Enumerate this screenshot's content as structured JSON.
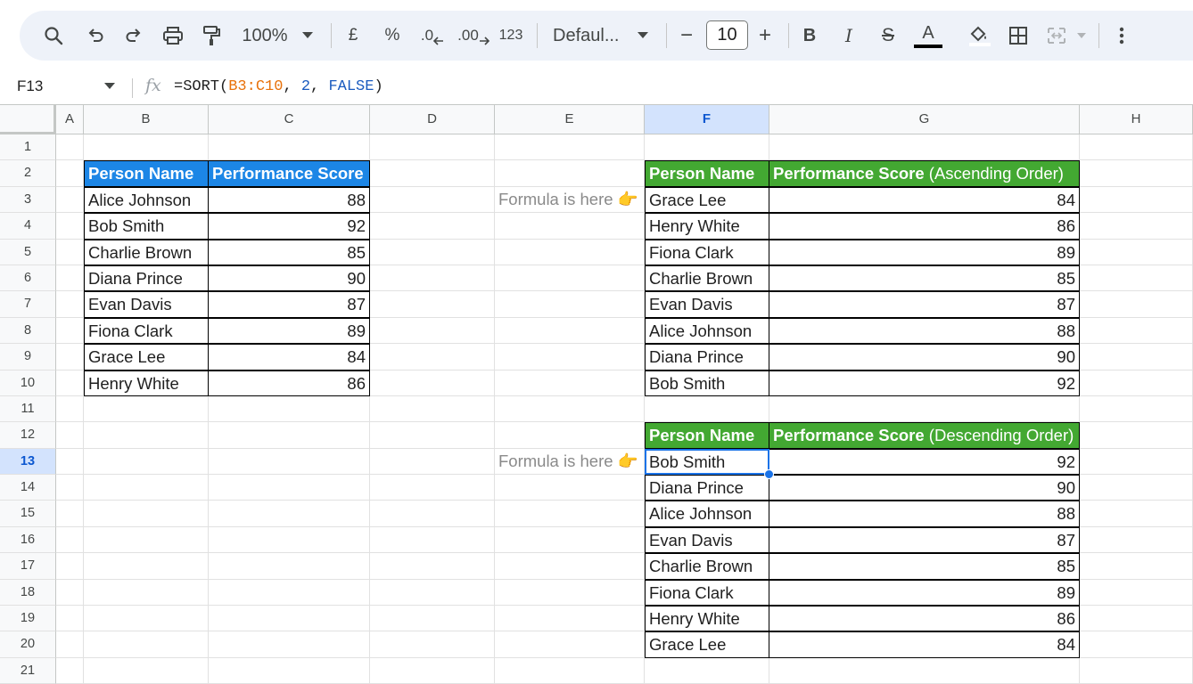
{
  "toolbar": {
    "zoom": "100%",
    "currency": "£",
    "percent": "%",
    "decrease_decimal": ".0",
    "increase_decimal": ".00",
    "more_formats": "123",
    "font": "Defaul...",
    "font_size": "10",
    "minus": "−",
    "plus": "+",
    "bold": "B",
    "italic": "I",
    "strike": "S",
    "text_color_letter": "A",
    "text_color": "#000000"
  },
  "formula_bar": {
    "name_box": "F13",
    "fx": "fx",
    "f_prefix": "=SORT(",
    "f_range": "B3:C10",
    "f_comma1": ", ",
    "f_num": "2",
    "f_comma2": ", ",
    "f_bool": "FALSE",
    "f_suffix": ")"
  },
  "columns": [
    "A",
    "B",
    "C",
    "D",
    "E",
    "F",
    "G",
    "H"
  ],
  "rows": [
    "1",
    "2",
    "3",
    "4",
    "5",
    "6",
    "7",
    "8",
    "9",
    "10",
    "11",
    "12",
    "13",
    "14",
    "15",
    "16",
    "17",
    "18",
    "19",
    "20",
    "21"
  ],
  "source_table": {
    "header_name": "Person Name",
    "header_score": "Performance Score",
    "rows": [
      {
        "name": "Alice Johnson",
        "score": "88"
      },
      {
        "name": "Bob Smith",
        "score": "92"
      },
      {
        "name": "Charlie Brown",
        "score": "85"
      },
      {
        "name": "Diana Prince",
        "score": "90"
      },
      {
        "name": "Evan Davis",
        "score": "87"
      },
      {
        "name": "Fiona Clark",
        "score": "89"
      },
      {
        "name": "Grace Lee",
        "score": "84"
      },
      {
        "name": "Henry White",
        "score": "86"
      }
    ]
  },
  "notes": {
    "ascending": "Formula is here 👉",
    "descending": "Formula is here 👉"
  },
  "ascending_table": {
    "header_name": "Person Name",
    "header_score_bold": "Performance Score",
    "header_score_rest": " (Ascending Order)",
    "rows": [
      {
        "name": "Grace Lee",
        "score": "84"
      },
      {
        "name": "Henry White",
        "score": "86"
      },
      {
        "name": "Fiona Clark",
        "score": "89"
      },
      {
        "name": "Charlie Brown",
        "score": "85"
      },
      {
        "name": "Evan Davis",
        "score": "87"
      },
      {
        "name": "Alice Johnson",
        "score": "88"
      },
      {
        "name": "Diana Prince",
        "score": "90"
      },
      {
        "name": "Bob Smith",
        "score": "92"
      }
    ]
  },
  "descending_table": {
    "header_name": "Person Name",
    "header_score_bold": "Performance Score",
    "header_score_rest": " (Descending Order)",
    "rows": [
      {
        "name": "Bob Smith",
        "score": "92"
      },
      {
        "name": "Diana Prince",
        "score": "90"
      },
      {
        "name": "Alice Johnson",
        "score": "88"
      },
      {
        "name": "Evan Davis",
        "score": "87"
      },
      {
        "name": "Charlie Brown",
        "score": "85"
      },
      {
        "name": "Fiona Clark",
        "score": "89"
      },
      {
        "name": "Henry White",
        "score": "86"
      },
      {
        "name": "Grace Lee",
        "score": "84"
      }
    ]
  },
  "colors": {
    "blue_header": "#1c86e6",
    "green_header": "#43a832",
    "selection": "#1a73e8"
  }
}
